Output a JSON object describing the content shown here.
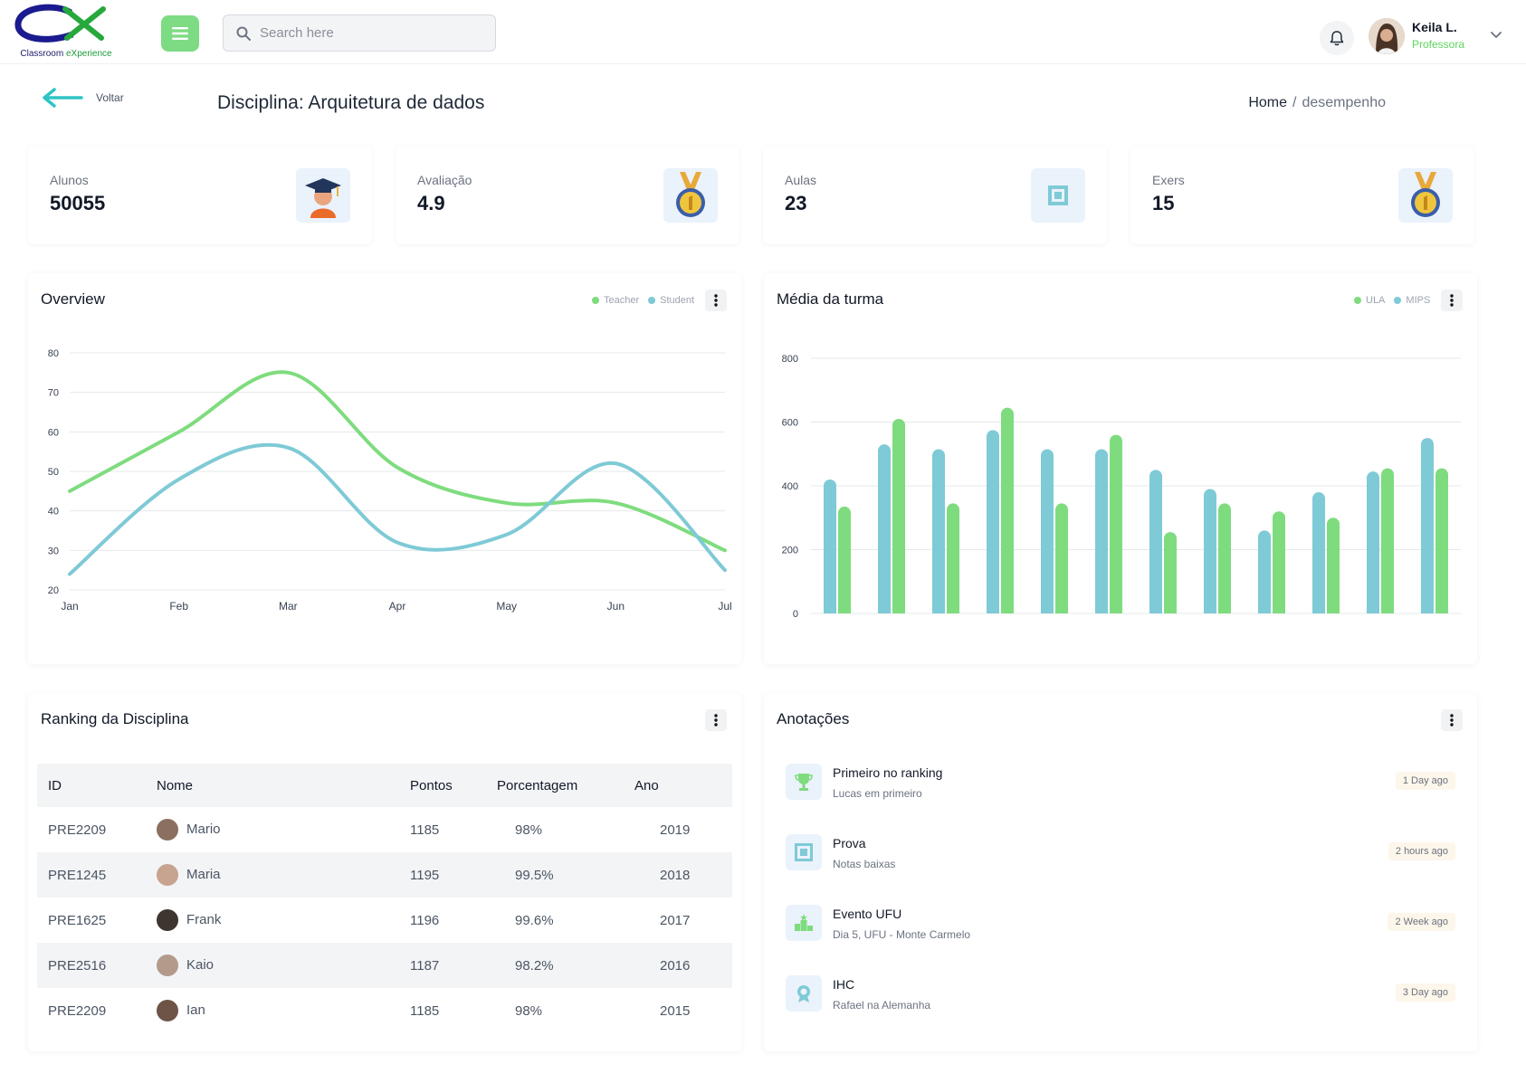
{
  "header": {
    "logo_text_a": "Classroom",
    "logo_text_b": "eXperience",
    "search_placeholder": "Search here",
    "user_name": "Keila L.",
    "user_role": "Professora"
  },
  "page": {
    "back_label": "Voltar",
    "title": "Disciplina: Arquitetura de dados",
    "breadcrumb_home": "Home",
    "breadcrumb_sep": "/",
    "breadcrumb_current": "desempenho"
  },
  "stats": [
    {
      "label": "Alunos",
      "value": "50055",
      "icon": "graduate-icon"
    },
    {
      "label": "Avaliação",
      "value": "4.9",
      "icon": "medal-icon"
    },
    {
      "label": "Aulas",
      "value": "23",
      "icon": "frame-icon"
    },
    {
      "label": "Exers",
      "value": "15",
      "icon": "medal-icon"
    }
  ],
  "colors": {
    "green": "#7edc7e",
    "blue": "#7ecad6",
    "menu_green": "#7ddb84"
  },
  "overview": {
    "title": "Overview",
    "legend": [
      "Teacher",
      "Student"
    ]
  },
  "media": {
    "title": "Média da turma",
    "legend": [
      "ULA",
      "MIPS"
    ]
  },
  "chart_data": [
    {
      "type": "line",
      "title": "Overview",
      "categories": [
        "Jan",
        "Feb",
        "Mar",
        "Apr",
        "May",
        "Jun",
        "Jul"
      ],
      "yticks": [
        20,
        30,
        40,
        50,
        60,
        70,
        80
      ],
      "ylim": [
        20,
        80
      ],
      "grid": true,
      "legend_position": "top-right",
      "series": [
        {
          "name": "Teacher",
          "color": "#7edc7e",
          "values": [
            45,
            60,
            75,
            51,
            42,
            42,
            30
          ]
        },
        {
          "name": "Student",
          "color": "#7ecad6",
          "values": [
            24,
            48,
            56,
            32,
            34,
            52,
            25
          ]
        }
      ]
    },
    {
      "type": "bar",
      "title": "Média da turma",
      "categories": [
        "",
        "",
        "",
        "",
        "",
        "",
        "",
        "",
        "",
        "",
        "",
        ""
      ],
      "yticks": [
        0,
        200,
        400,
        600,
        800
      ],
      "ylim": [
        0,
        800
      ],
      "grid": true,
      "legend_position": "top-right",
      "series": [
        {
          "name": "MIPS",
          "color": "#7ecad6",
          "values": [
            420,
            530,
            515,
            575,
            515,
            515,
            450,
            390,
            260,
            380,
            445,
            550
          ]
        },
        {
          "name": "ULA",
          "color": "#7edc7e",
          "values": [
            335,
            610,
            345,
            645,
            345,
            560,
            255,
            345,
            320,
            300,
            455,
            455
          ]
        }
      ]
    }
  ],
  "ranking": {
    "title": "Ranking da Disciplina",
    "headers": [
      "ID",
      "Nome",
      "Pontos",
      "Porcentagem",
      "Ano"
    ],
    "rows": [
      {
        "id": "PRE2209",
        "nome": "Mario",
        "pontos": "1185",
        "pct": "98%",
        "ano": "2019",
        "avatar": "#8b6f60"
      },
      {
        "id": "PRE1245",
        "nome": "Maria",
        "pontos": "1195",
        "pct": "99.5%",
        "ano": "2018",
        "avatar": "#c7a48f"
      },
      {
        "id": "PRE1625",
        "nome": "Frank",
        "pontos": "1196",
        "pct": "99.6%",
        "ano": "2017",
        "avatar": "#3d3530"
      },
      {
        "id": "PRE2516",
        "nome": "Kaio",
        "pontos": "1187",
        "pct": "98.2%",
        "ano": "2016",
        "avatar": "#b39a8a"
      },
      {
        "id": "PRE2209",
        "nome": "Ian",
        "pontos": "1185",
        "pct": "98%",
        "ano": "2015",
        "avatar": "#6d5447"
      }
    ]
  },
  "notes": {
    "title": "Anotações",
    "items": [
      {
        "title": "Primeiro no ranking",
        "sub": "Lucas em primeiro",
        "time": "1 Day ago",
        "icon": "trophy-icon"
      },
      {
        "title": "Prova",
        "sub": "Notas baixas",
        "time": "2 hours ago",
        "icon": "frame-icon"
      },
      {
        "title": "Evento UFU",
        "sub": "Dia 5, UFU - Monte Carmelo",
        "time": "2 Week ago",
        "icon": "podium-icon"
      },
      {
        "title": "IHC",
        "sub": "Rafael na Alemanha",
        "time": "3 Day ago",
        "icon": "badge-icon"
      }
    ]
  }
}
